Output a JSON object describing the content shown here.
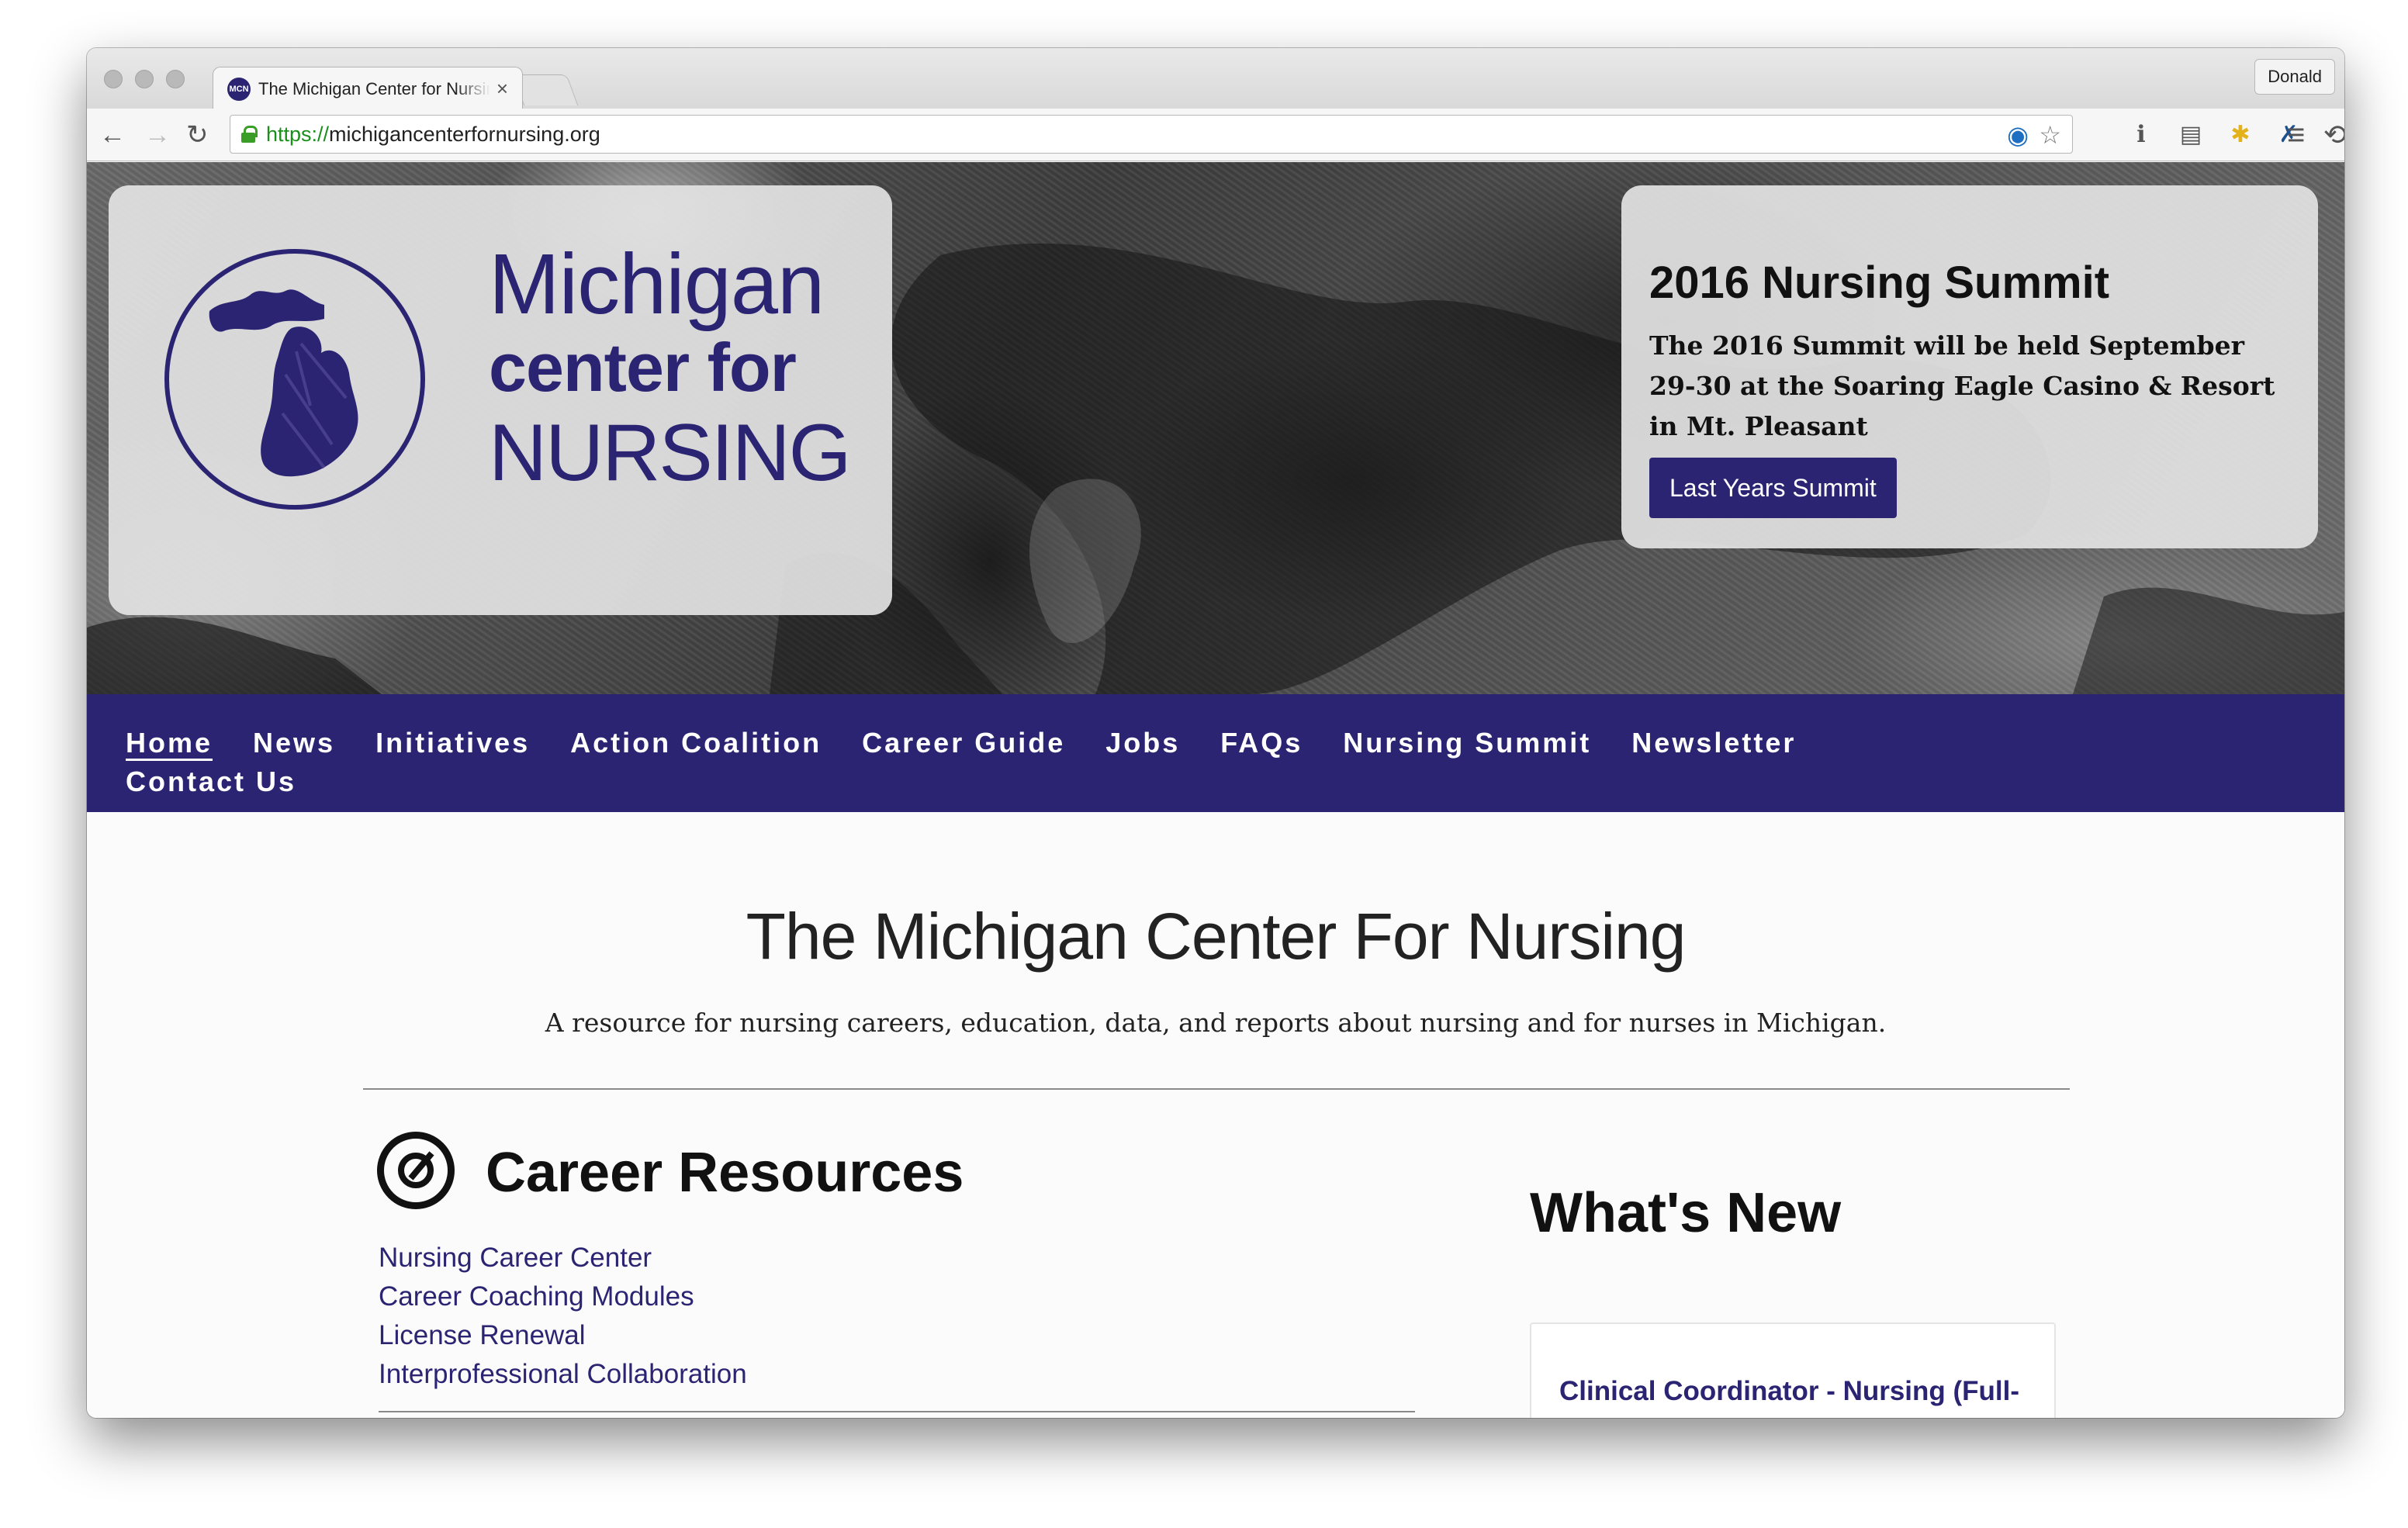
{
  "browser": {
    "tab_title": "The Michigan Center for Nursing",
    "tab_favicon_text": "MCN",
    "tab_close": "×",
    "profile_name": "Donald",
    "url_scheme": "https://",
    "url_host": "michigancenterfornursing.org",
    "back_glyph": "←",
    "forward_glyph": "→",
    "reload_glyph": "↻",
    "icons": [
      "edge-extension-icon",
      "bookmark-star-icon",
      "info-icon",
      "reader-icon",
      "puzzle-extension-icon",
      "tool-extension-icon",
      "sync-extension-icon",
      "menu-icon"
    ]
  },
  "hero": {
    "logo": {
      "line1": "Michigan",
      "line2": "center for",
      "line3": "NURSING"
    },
    "summit": {
      "title": "2016 Nursing Summit",
      "text": "The 2016 Summit will be held September 29-30 at the Soaring Eagle Casino & Resort in Mt. Pleasant",
      "button": "Last Years Summit"
    }
  },
  "nav": {
    "items": [
      "Home",
      "News",
      "Initiatives",
      "Action Coalition",
      "Career Guide",
      "Jobs",
      "FAQs",
      "Nursing Summit",
      "Newsletter",
      "Contact Us"
    ],
    "active": "Home"
  },
  "intro": {
    "title": "The Michigan Center For Nursing",
    "subtitle": "A resource for nursing careers, education, data, and reports about nursing and for nurses in Michigan."
  },
  "career": {
    "title": "Career Resources",
    "links": [
      "Nursing Career Center",
      "Career Coaching Modules",
      "License Renewal",
      "Interprofessional Collaboration"
    ]
  },
  "whats_new": {
    "title": "What's New",
    "items": [
      "Clinical Coordinator - Nursing (Full-Time)"
    ]
  },
  "colors": {
    "brand": "#2b2472",
    "link": "#2b2472",
    "ssl_green": "#3a9d28"
  }
}
